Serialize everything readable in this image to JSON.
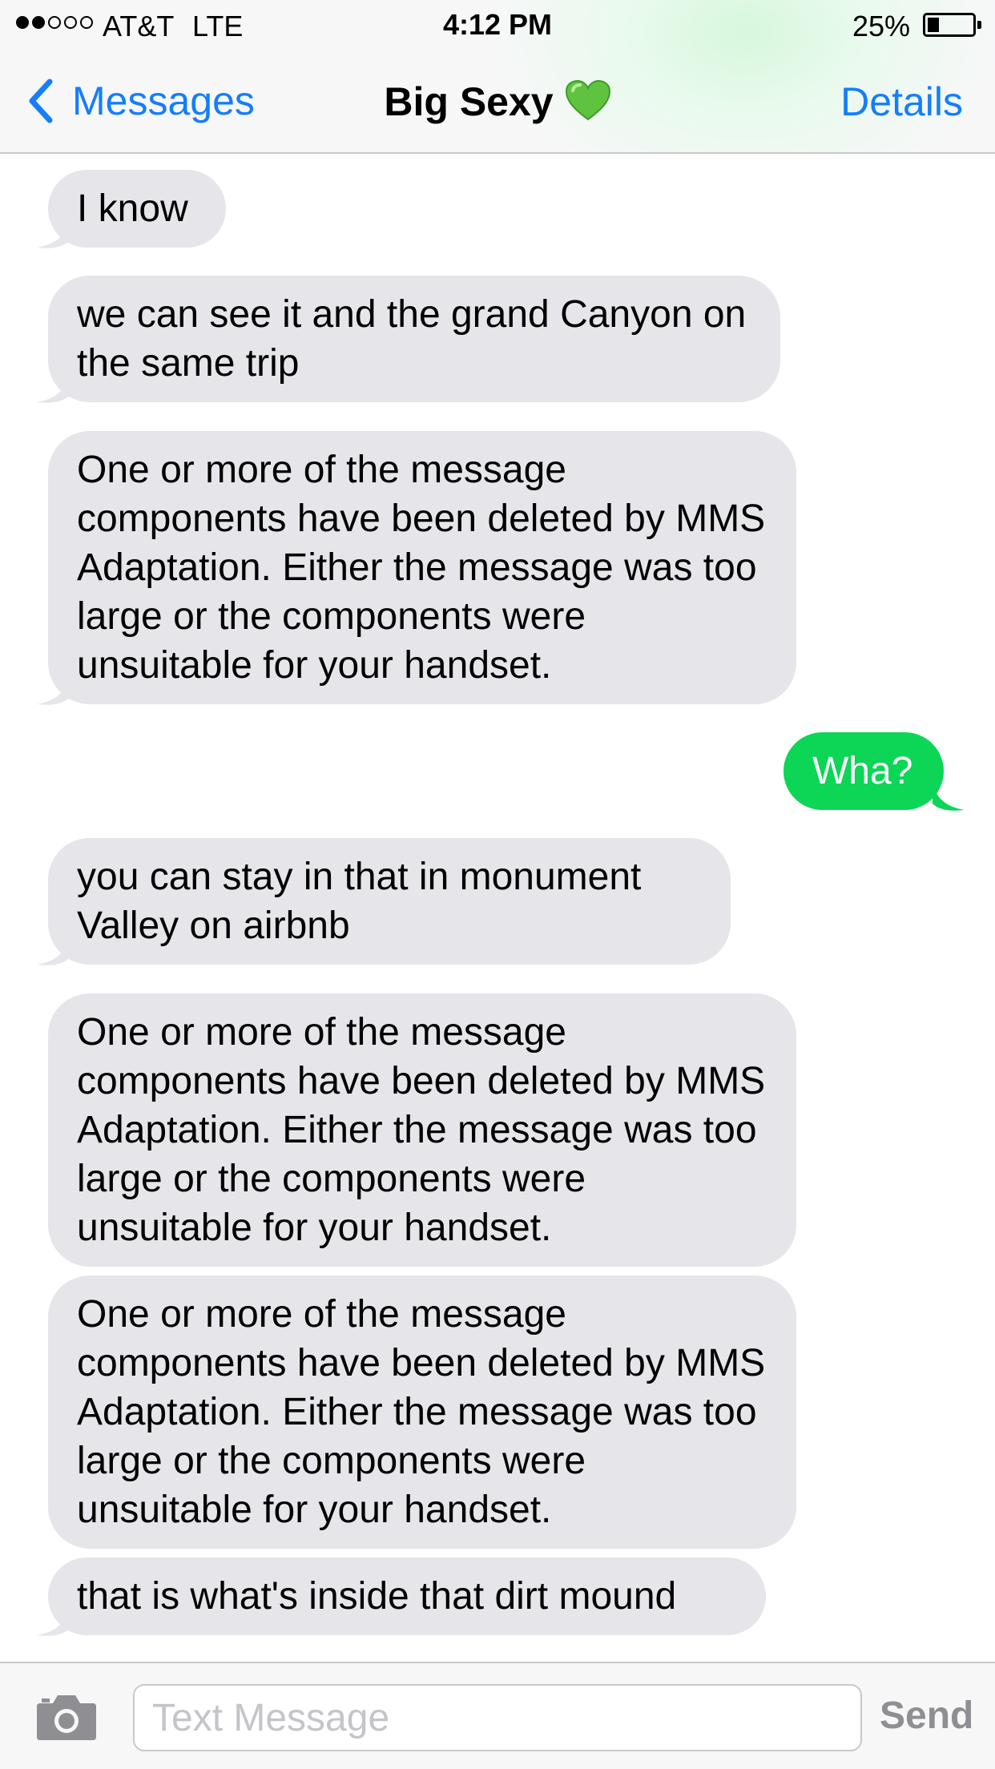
{
  "status_bar": {
    "carrier": "AT&T",
    "network": "LTE",
    "time": "4:12 PM",
    "battery_percent": "25%",
    "battery_level": 0.25,
    "signal_bars": 2,
    "signal_total": 5
  },
  "nav": {
    "back_label": "Messages",
    "title": "Big Sexy",
    "title_emoji": "green-heart-icon",
    "details_label": "Details"
  },
  "messages": [
    {
      "direction": "incoming",
      "text": "I know"
    },
    {
      "direction": "incoming",
      "text": "we can see it and the grand Canyon on the same trip"
    },
    {
      "direction": "incoming",
      "text": "One or more of the message components have been deleted by MMS Adaptation. Either the message was too large or the components were unsuitable for your handset."
    },
    {
      "direction": "outgoing",
      "text": "Wha?"
    },
    {
      "direction": "incoming",
      "text": "you can stay in that in monument Valley on airbnb"
    },
    {
      "direction": "incoming",
      "text": "One or more of the message components have been deleted by MMS Adaptation. Either the message was too large or the components were unsuitable for your handset."
    },
    {
      "direction": "incoming",
      "text": "One or more of the message components have been deleted by MMS Adaptation. Either the message was too large or the components were unsuitable for your handset."
    },
    {
      "direction": "incoming",
      "text": "that is what's inside that dirt mound"
    }
  ],
  "input": {
    "placeholder": "Text Message",
    "value": "",
    "send_label": "Send",
    "camera_icon": "camera-icon"
  },
  "colors": {
    "accent": "#147efb",
    "outgoing_bubble": "#0dd556",
    "incoming_bubble": "#e5e5ea",
    "send_disabled": "#8e8e93"
  }
}
